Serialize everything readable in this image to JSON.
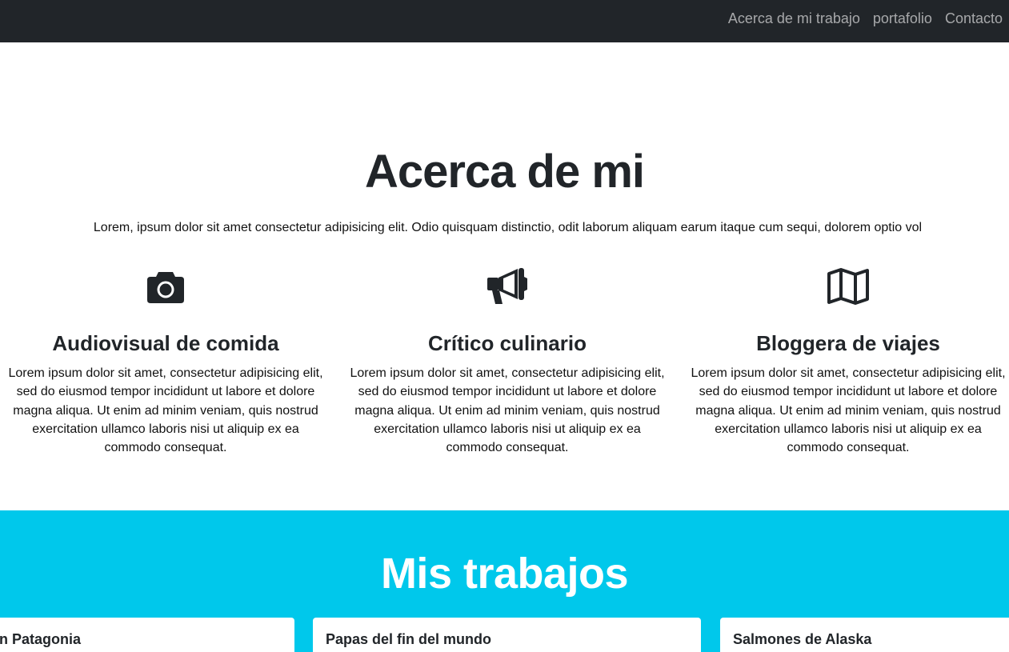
{
  "nav": {
    "links": [
      "Acerca de mi trabajo",
      "portafolio",
      "Contacto"
    ]
  },
  "about": {
    "title": "Acerca de mi",
    "lead": "Lorem, ipsum dolor sit amet consectetur adipisicing elit. Odio quisquam distinctio, odit laborum aliquam earum itaque cum sequi, dolorem optio vol",
    "features": [
      {
        "icon": "camera-icon",
        "title": "Audiovisual de comida",
        "text": "Lorem ipsum dolor sit amet, consectetur adipisicing elit, sed do eiusmod tempor incididunt ut labore et dolore magna aliqua. Ut enim ad minim veniam, quis nostrud exercitation ullamco laboris nisi ut aliquip ex ea commodo consequat."
      },
      {
        "icon": "megaphone-icon",
        "title": "Crítico culinario",
        "text": "Lorem ipsum dolor sit amet, consectetur adipisicing elit, sed do eiusmod tempor incididunt ut labore et dolore magna aliqua. Ut enim ad minim veniam, quis nostrud exercitation ullamco laboris nisi ut aliquip ex ea commodo consequat."
      },
      {
        "icon": "map-icon",
        "title": "Bloggera de viajes",
        "text": "Lorem ipsum dolor sit amet, consectetur adipisicing elit, sed do eiusmod tempor incididunt ut labore et dolore magna aliqua. Ut enim ad minim veniam, quis nostrud exercitation ullamco laboris nisi ut aliquip ex ea commodo consequat."
      }
    ]
  },
  "works": {
    "title": "Mis trabajos",
    "cards": [
      "n Patagonia",
      "Papas del fin del mundo",
      "Salmones de Alaska"
    ]
  },
  "colors": {
    "navbar": "#212529",
    "works_bg": "#00c8eb",
    "text": "#212529"
  }
}
